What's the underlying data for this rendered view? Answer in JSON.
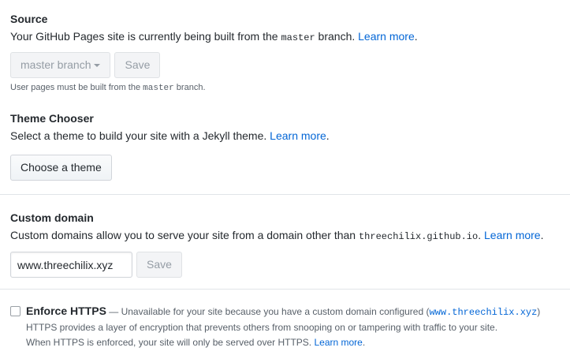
{
  "source": {
    "heading": "Source",
    "desc_before": "Your GitHub Pages site is currently being built from the ",
    "desc_code": "master",
    "desc_after": " branch. ",
    "learn_more": "Learn more",
    "desc_end": ".",
    "branch_select": "master branch",
    "save_label": "Save",
    "note_before": "User pages must be built from the ",
    "note_code": "master",
    "note_after": " branch."
  },
  "theme": {
    "heading": "Theme Chooser",
    "desc": "Select a theme to build your site with a Jekyll theme. ",
    "learn_more": "Learn more",
    "desc_end": ".",
    "button_label": "Choose a theme"
  },
  "custom_domain": {
    "heading": "Custom domain",
    "desc_before": "Custom domains allow you to serve your site from a domain other than ",
    "desc_code": "threechilix.github.io",
    "desc_after": ". ",
    "learn_more": "Learn more",
    "desc_end": ".",
    "input_value": "www.threechilix.xyz",
    "save_label": "Save"
  },
  "https": {
    "title": "Enforce HTTPS",
    "dash_text": " — Unavailable for your site because you have a custom domain configured (",
    "domain_code": "www.threechilix.xyz",
    "close_paren": ")",
    "line2": "HTTPS provides a layer of encryption that prevents others from snooping on or tampering with traffic to your site.",
    "line3": "When HTTPS is enforced, your site will only be served over HTTPS. ",
    "learn_more": "Learn more",
    "end": "."
  },
  "colors": {
    "link": "#0366d6",
    "text": "#24292e",
    "muted": "#586069",
    "border": "#e1e4e8"
  }
}
